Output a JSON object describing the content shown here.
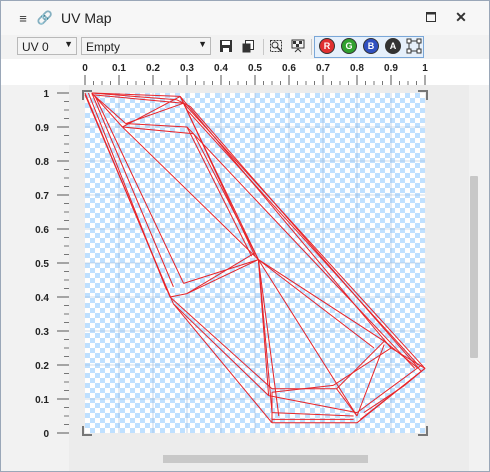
{
  "window": {
    "title": "UV Map"
  },
  "toolbar": {
    "uv_select": "UV 0",
    "material_select": "Empty",
    "channels": [
      {
        "label": "R",
        "color": "#e03030"
      },
      {
        "label": "G",
        "color": "#30a030"
      },
      {
        "label": "B",
        "color": "#3050c0"
      },
      {
        "label": "A",
        "color": "#333333"
      }
    ]
  },
  "colors": {
    "wire": "#e8252a",
    "checker_a": "#bfe0ff",
    "checker_b": "#ffffff"
  },
  "ruler": {
    "x_ticks": [
      "0",
      "0.1",
      "0.2",
      "0.3",
      "0.4",
      "0.5",
      "0.6",
      "0.7",
      "0.8",
      "0.9",
      "1"
    ],
    "y_ticks": [
      "1",
      "0.9",
      "0.8",
      "0.7",
      "0.6",
      "0.5",
      "0.4",
      "0.3",
      "0.2",
      "0.1",
      "0"
    ]
  },
  "uv_wire": [
    [
      [
        0.02,
        1.0
      ],
      [
        0.27,
        0.98
      ]
    ],
    [
      [
        0.02,
        1.0
      ],
      [
        0.28,
        0.99
      ]
    ],
    [
      [
        0.02,
        0.995
      ],
      [
        0.29,
        0.97
      ]
    ],
    [
      [
        0.28,
        0.99
      ],
      [
        0.3,
        0.95
      ]
    ],
    [
      [
        0.27,
        0.98
      ],
      [
        0.31,
        0.96
      ]
    ],
    [
      [
        0.02,
        1.0
      ],
      [
        0.11,
        0.9
      ]
    ],
    [
      [
        0.03,
        0.99
      ],
      [
        0.12,
        0.91
      ]
    ],
    [
      [
        0.11,
        0.9
      ],
      [
        0.32,
        0.88
      ]
    ],
    [
      [
        0.12,
        0.91
      ],
      [
        0.3,
        0.9
      ]
    ],
    [
      [
        0.12,
        0.91
      ],
      [
        0.29,
        0.97
      ]
    ],
    [
      [
        0.11,
        0.9
      ],
      [
        0.28,
        0.99
      ]
    ],
    [
      [
        0.0,
        1.0
      ],
      [
        0.25,
        0.4
      ]
    ],
    [
      [
        0.01,
        1.0
      ],
      [
        0.24,
        0.42
      ]
    ],
    [
      [
        0.02,
        1.0
      ],
      [
        0.26,
        0.43
      ]
    ],
    [
      [
        0.03,
        0.99
      ],
      [
        0.29,
        0.44
      ]
    ],
    [
      [
        0.0,
        0.995
      ],
      [
        0.26,
        0.38
      ]
    ],
    [
      [
        0.25,
        0.4
      ],
      [
        0.3,
        0.41
      ]
    ],
    [
      [
        0.11,
        0.9
      ],
      [
        0.51,
        0.51
      ]
    ],
    [
      [
        0.28,
        0.99
      ],
      [
        0.51,
        0.51
      ]
    ],
    [
      [
        0.29,
        0.97
      ],
      [
        0.5,
        0.52
      ]
    ],
    [
      [
        0.32,
        0.88
      ],
      [
        0.51,
        0.51
      ]
    ],
    [
      [
        0.3,
        0.9
      ],
      [
        0.49,
        0.52
      ]
    ],
    [
      [
        0.3,
        0.41
      ],
      [
        0.51,
        0.51
      ]
    ],
    [
      [
        0.3,
        0.41
      ],
      [
        0.5,
        0.53
      ]
    ],
    [
      [
        0.29,
        0.44
      ],
      [
        0.51,
        0.51
      ]
    ],
    [
      [
        0.51,
        0.51
      ],
      [
        0.55,
        0.06
      ]
    ],
    [
      [
        0.51,
        0.51
      ],
      [
        0.54,
        0.11
      ]
    ],
    [
      [
        0.51,
        0.51
      ],
      [
        0.57,
        0.05
      ]
    ],
    [
      [
        0.51,
        0.51
      ],
      [
        0.8,
        0.05
      ]
    ],
    [
      [
        0.51,
        0.51
      ],
      [
        0.88,
        0.27
      ]
    ],
    [
      [
        0.51,
        0.51
      ],
      [
        0.85,
        0.25
      ]
    ],
    [
      [
        0.26,
        0.38
      ],
      [
        0.54,
        0.11
      ]
    ],
    [
      [
        0.25,
        0.4
      ],
      [
        0.55,
        0.13
      ]
    ],
    [
      [
        0.26,
        0.38
      ],
      [
        0.55,
        0.03
      ]
    ],
    [
      [
        0.28,
        0.99
      ],
      [
        0.9,
        0.25
      ]
    ],
    [
      [
        0.29,
        0.97
      ],
      [
        1.0,
        0.19
      ]
    ],
    [
      [
        0.3,
        0.95
      ],
      [
        0.98,
        0.2
      ]
    ],
    [
      [
        0.31,
        0.96
      ],
      [
        0.99,
        0.18
      ]
    ],
    [
      [
        0.3,
        0.9
      ],
      [
        0.97,
        0.19
      ]
    ],
    [
      [
        0.55,
        0.13
      ],
      [
        0.74,
        0.13
      ]
    ],
    [
      [
        0.55,
        0.12
      ],
      [
        0.73,
        0.14
      ]
    ],
    [
      [
        0.54,
        0.11
      ],
      [
        0.8,
        0.06
      ]
    ],
    [
      [
        0.55,
        0.03
      ],
      [
        0.8,
        0.03
      ]
    ],
    [
      [
        0.55,
        0.06
      ],
      [
        0.79,
        0.05
      ]
    ],
    [
      [
        0.55,
        0.04
      ],
      [
        0.79,
        0.04
      ]
    ],
    [
      [
        0.74,
        0.13
      ],
      [
        0.8,
        0.05
      ]
    ],
    [
      [
        0.73,
        0.14
      ],
      [
        0.9,
        0.25
      ]
    ],
    [
      [
        0.74,
        0.13
      ],
      [
        0.88,
        0.27
      ]
    ],
    [
      [
        0.8,
        0.05
      ],
      [
        0.88,
        0.26
      ]
    ],
    [
      [
        0.81,
        0.04
      ],
      [
        1.0,
        0.19
      ]
    ],
    [
      [
        0.8,
        0.06
      ],
      [
        0.99,
        0.2
      ]
    ],
    [
      [
        0.8,
        0.03
      ],
      [
        1.0,
        0.19
      ]
    ],
    [
      [
        0.9,
        0.25
      ],
      [
        1.0,
        0.19
      ]
    ],
    [
      [
        0.88,
        0.27
      ],
      [
        0.98,
        0.19
      ]
    ],
    [
      [
        0.82,
        0.06
      ],
      [
        0.94,
        0.14
      ]
    ],
    [
      [
        0.94,
        0.14
      ],
      [
        1.0,
        0.19
      ]
    ],
    [
      [
        0.55,
        0.12
      ],
      [
        0.55,
        0.03
      ]
    ]
  ]
}
